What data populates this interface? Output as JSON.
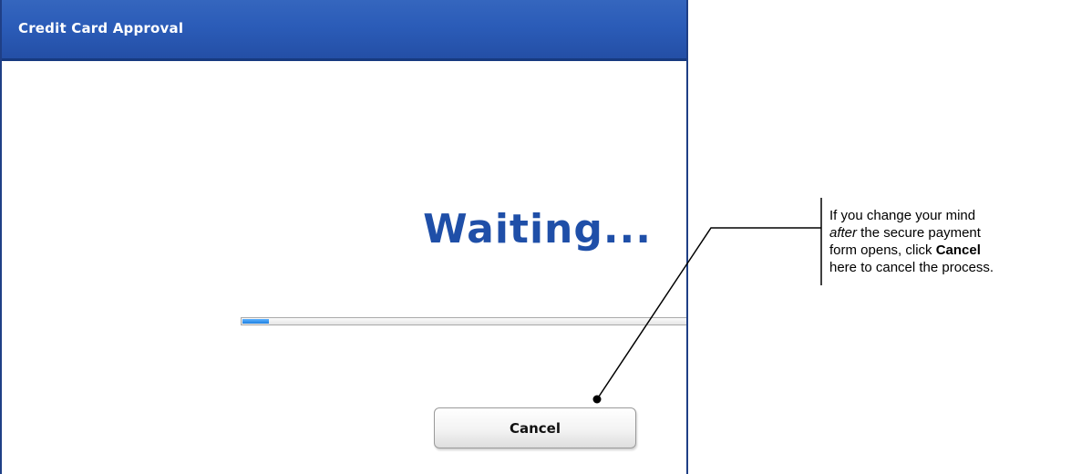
{
  "dialog": {
    "title": "Credit Card Approval",
    "status_text": "Waiting...",
    "progress_percent": 6,
    "cancel_label": "Cancel"
  },
  "callout": {
    "line1": "If you change your mind",
    "line2_em": "after",
    "line2_rest": " the secure payment",
    "line3_pre": "form opens, click ",
    "line3_bold": "Cancel",
    "line4": "here to cancel the process."
  },
  "colors": {
    "titlebar": "#2b5cb8",
    "waiting_text": "#1f4fa8",
    "progress_fill": "#1f80e0"
  }
}
